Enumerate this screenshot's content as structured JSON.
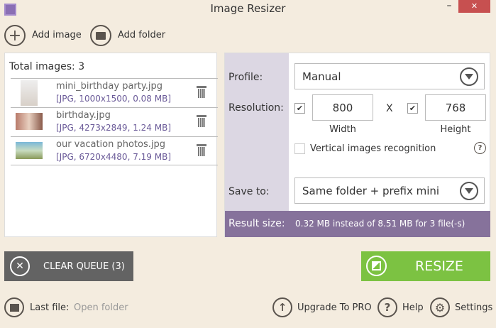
{
  "window": {
    "title": "Image Resizer",
    "minimize": "–",
    "close": "✕"
  },
  "toolbar": {
    "add_image": "Add image",
    "add_folder": "Add folder"
  },
  "list": {
    "total": "Total images: 3",
    "items": [
      {
        "name": "mini_birthday party.jpg",
        "info": "[JPG, 1000x1500, 0.08 MB]"
      },
      {
        "name": "birthday.jpg",
        "info": "[JPG, 4273x2849, 1.24 MB]"
      },
      {
        "name": "our vacation photos.jpg",
        "info": "[JPG, 6720x4480, 7.19 MB]"
      }
    ]
  },
  "settings": {
    "profile_label": "Profile:",
    "profile_value": "Manual",
    "resolution_label": "Resolution:",
    "width": "800",
    "height": "768",
    "x": "X",
    "width_label": "Width",
    "height_label": "Height",
    "width_checked": true,
    "height_checked": true,
    "vertical_label": "Vertical images recognition",
    "vertical_checked": false,
    "help": "?",
    "save_label": "Save to:",
    "save_value": "Same folder + prefix mini",
    "result_label": "Result size:",
    "result_value": "0.32 MB instead of 8.51 MB for 3 file(-s)"
  },
  "actions": {
    "clear": "CLEAR QUEUE (3)",
    "resize": "RESIZE"
  },
  "footer": {
    "last_file": "Last file:",
    "open_folder": "Open folder",
    "upgrade": "Upgrade To PRO",
    "help": "Help",
    "settings": "Settings"
  },
  "colors": {
    "accent": "#86729b",
    "resize": "#7cc242",
    "clear": "#636363",
    "close": "#c75050"
  }
}
